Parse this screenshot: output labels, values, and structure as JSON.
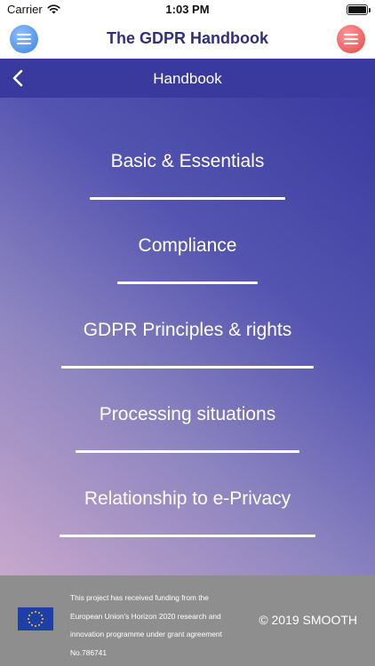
{
  "status_bar": {
    "carrier": "Carrier",
    "time": "1:03 PM"
  },
  "header": {
    "title": "The GDPR Handbook",
    "left_button_icon": "menu-icon",
    "right_button_icon": "menu-icon"
  },
  "nav": {
    "title": "Handbook",
    "back_icon": "chevron-left-icon"
  },
  "menu": {
    "items": [
      {
        "label": "Basic & Essentials"
      },
      {
        "label": "Compliance"
      },
      {
        "label": "GDPR Principles & rights"
      },
      {
        "label": "Processing situations"
      },
      {
        "label": "Relationship to e-Privacy"
      }
    ]
  },
  "footer": {
    "funding_lines": [
      "This project has received funding from the",
      "European Union's Horizon 2020 research and",
      "innovation programme under grant agreement",
      "No.786741"
    ],
    "copyright": "© 2019 SMOOTH",
    "flag_icon": "eu-flag-icon"
  },
  "colors": {
    "header_title": "#2e2f7e",
    "nav_bar": "#3a3a9e",
    "gradient_start": "#3a3aa0",
    "gradient_end": "#c8a8cc",
    "footer": "#8e8e8e",
    "left_button": "#3d7fe0",
    "right_button": "#e04545"
  }
}
